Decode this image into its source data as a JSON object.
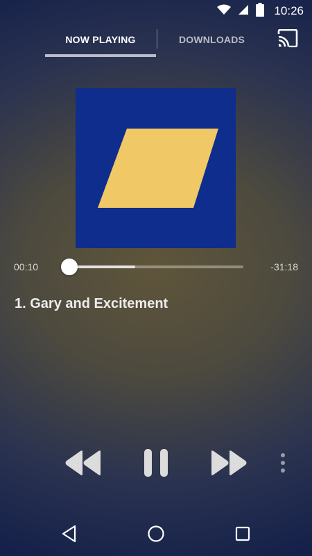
{
  "status_bar": {
    "time": "10:26",
    "icons": [
      "wifi-icon",
      "cell-signal-icon",
      "battery-icon"
    ]
  },
  "tabs": [
    {
      "label": "NOW PLAYING",
      "selected": true
    },
    {
      "label": "DOWNLOADS",
      "selected": false
    }
  ],
  "cast": {
    "icon": "cast-icon"
  },
  "player": {
    "elapsed": "00:10",
    "remaining": "-31:18",
    "progress_fraction": 0.005,
    "buffered_fraction": 0.38,
    "track_title": "1. Gary and Excitement"
  },
  "controls": {
    "icons": [
      "rewind-icon",
      "pause-icon",
      "fast-forward-icon",
      "more-vert-icon"
    ]
  },
  "nav": {
    "icons": [
      "back-icon",
      "home-icon",
      "recents-icon"
    ]
  },
  "colors": {
    "art_background": "#0e2d8c",
    "art_stripes": "#f0c866",
    "tab_indicator": "#b8bccb"
  }
}
